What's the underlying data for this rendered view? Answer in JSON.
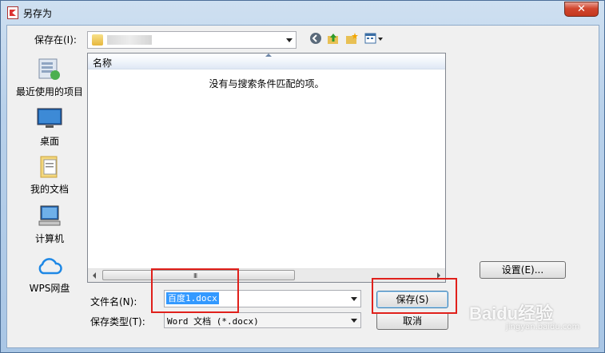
{
  "window": {
    "title": "另存为",
    "close_glyph": "✕"
  },
  "save_in": {
    "label": "保存在(I):",
    "value": ""
  },
  "places": [
    {
      "label": "最近使用的项目"
    },
    {
      "label": "桌面"
    },
    {
      "label": "我的文档"
    },
    {
      "label": "计算机"
    },
    {
      "label": "WPS网盘"
    }
  ],
  "list": {
    "column_name": "名称",
    "empty_message": "没有与搜索条件匹配的项。",
    "scroll_grip": "III"
  },
  "settings_button": "设置(E)...",
  "filename": {
    "label": "文件名(N):",
    "value": "百度1.docx"
  },
  "filetype": {
    "label": "保存类型(T):",
    "value": "Word 文档 (*.docx)"
  },
  "buttons": {
    "save": "保存(S)",
    "cancel": "取消"
  },
  "watermark": {
    "brand": "Baidu经验",
    "url": "jingyan.baidu.com"
  },
  "colors": {
    "annotation": "#e0201b",
    "selection": "#3399ff"
  },
  "icons": [
    "pdf-app-icon",
    "close-icon",
    "folder-icon",
    "back-icon",
    "up-folder-icon",
    "new-folder-icon",
    "view-menu-icon",
    "recent-items-icon",
    "desktop-icon",
    "documents-icon",
    "computer-icon",
    "cloud-icon"
  ]
}
